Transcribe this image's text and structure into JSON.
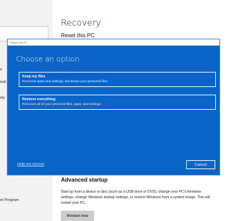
{
  "sidebar": {
    "items": [
      {
        "label": "e"
      },
      {
        "label": "izat"
      },
      {
        "label": "rity"
      },
      {
        "label": "er Program"
      }
    ]
  },
  "settings": {
    "title": "Recovery",
    "subtitle": "Reset this PC",
    "advanced_heading": "Advanced startup",
    "advanced_desc": "Start up from a device or disc (such as a USB drive or DVD), change your PC's firmware settings, change Windows startup settings, or restore Windows from a system image. This will restart your PC.",
    "restart_label": "Restart now"
  },
  "dialog": {
    "caption": "Reset this PC",
    "title": "Choose an option",
    "options": [
      {
        "title": "Keep my files",
        "desc": "Removes apps and settings, but keeps your personal files."
      },
      {
        "title": "Remove everything",
        "desc": "Removes all of your personal files, apps, and settings."
      }
    ],
    "help_link": "Help me choose",
    "cancel_label": "Cancel"
  },
  "colors": {
    "dialog_blue": "#0a63c6",
    "link": "#bfe0ff"
  }
}
